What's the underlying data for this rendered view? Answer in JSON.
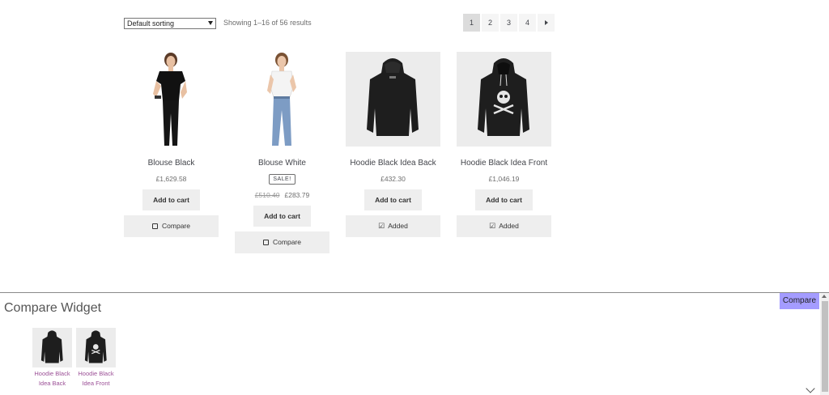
{
  "toolbar": {
    "sort_selected": "Default sorting",
    "result_count": "Showing 1–16 of 56 results"
  },
  "pagination": {
    "pages": [
      "1",
      "2",
      "3",
      "4"
    ],
    "current": "1",
    "next_icon": "arrow-right-icon"
  },
  "products": [
    {
      "title": "Blouse Black",
      "price": "£1,629.58",
      "add_to_cart": "Add to cart",
      "compare_label": "Compare",
      "compare_icon": "checkbox-empty-icon"
    },
    {
      "title": "Blouse White",
      "sale_badge": "SALE!",
      "old_price": "£510.40",
      "price": "£283.79",
      "add_to_cart": "Add to cart",
      "compare_label": "Compare",
      "compare_icon": "checkbox-empty-icon"
    },
    {
      "title": "Hoodie Black Idea Back",
      "price": "£432.30",
      "add_to_cart": "Add to cart",
      "compare_label": "Added",
      "compare_icon": "checkbox-checked-icon"
    },
    {
      "title": "Hoodie Black Idea Front",
      "price": "£1,046.19",
      "add_to_cart": "Add to cart",
      "compare_label": "Added",
      "compare_icon": "checkbox-checked-icon"
    }
  ],
  "compare_widget": {
    "title": "Compare Widget",
    "tab_label": "Compare",
    "items": [
      {
        "label_line1": "Hoodie Black",
        "label_line2": "Idea Back"
      },
      {
        "label_line1": "Hoodie Black",
        "label_line2": "Idea Front"
      }
    ]
  },
  "colors": {
    "accent_tab": "#a49cff",
    "link": "#9b4f96",
    "button_bg": "#eeeeee"
  }
}
